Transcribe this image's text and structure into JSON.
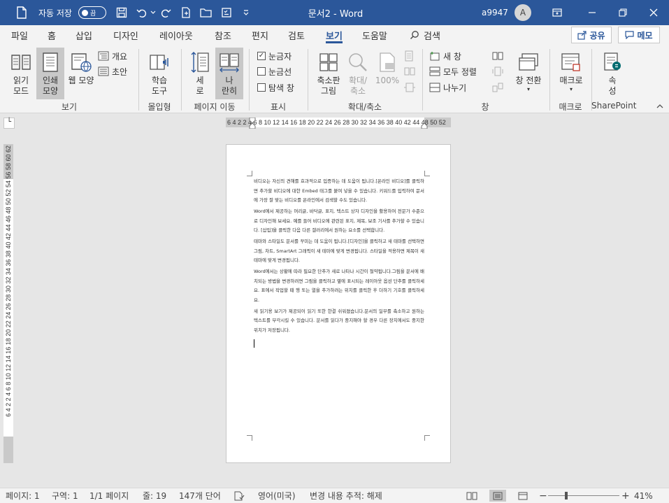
{
  "titlebar": {
    "autosave_label": "자동 저장",
    "autosave_state": "끔",
    "title": "문서2  -  Word",
    "user": "a9947",
    "avatar_initial": "A",
    "bg_color": "#2b579a"
  },
  "menu": {
    "tabs": [
      "파일",
      "홈",
      "삽입",
      "디자인",
      "레이아웃",
      "참조",
      "편지",
      "검토",
      "보기",
      "도움말",
      "검색"
    ],
    "active_tab": "보기",
    "share_label": "공유",
    "memo_label": "메모"
  },
  "ribbon": {
    "views": {
      "read_mode": "읽기\n모드",
      "print_layout": "인쇄\n모양",
      "web_layout": "웹 모양",
      "outline": "개요",
      "draft": "초안",
      "group_label": "보기"
    },
    "immersive": {
      "learning_tools": "학습\n도구",
      "group_label": "몰입형"
    },
    "page_movement": {
      "vertical": "세\n로",
      "side_to_side": "나\n란히",
      "group_label": "페이지 이동"
    },
    "show": {
      "ruler": "눈금자",
      "ruler_checked": true,
      "gridlines": "눈금선",
      "gridlines_checked": false,
      "nav_pane": "탐색 창",
      "nav_pane_checked": false,
      "group_label": "표시"
    },
    "zoom": {
      "zoom": "축소판\n그림",
      "zoom_btn": "확대/\n축소",
      "percent": "100%",
      "group_label": "확대/축소"
    },
    "window": {
      "new_window": "새 창",
      "arrange_all": "모두 정렬",
      "split": "나누기",
      "switch_windows": "창 전환",
      "group_label": "창"
    },
    "macros": {
      "macros": "매크로",
      "group_label": "매크로"
    },
    "sharepoint": {
      "properties": "속\n성",
      "group_label": "SharePoint"
    }
  },
  "ruler": {
    "horizontal": "6  4  2     2  4  6  8 10 12 14 16 18 20 22 24 26 28 30 32 34 36 38 40 42 44   48 50 52",
    "vertical": "6  4  2     2  4  6  8 10 12 14 16 18 20 22 24 26 28 30 32 34 36 38 40 42 44 46 48 50 52 54 56 58 60 62"
  },
  "document": {
    "paragraphs": [
      "비디오는 자신의 견해를 효과적으로 입증하는 데 도움이 됩니다.[온라인 비디오]를 클릭하면 추가할 비디오에 대한 Embed 태그를 붙여 넣을 수 있습니다. 키워드를 입력하여 문서에 가장 잘 맞는 비디오를 온라인에서 검색할 수도 있습니다.",
      "Word에서 제공하는 머리글, 바닥글, 표지, 텍스트 상자 디자인을 활용하여 전문가 수준으로 디자인해 보세요. 예를 들어 비디오에 관련된 표지, 제목, 보조 기사를 추가할 수 있습니다. [삽입]을 클릭한 다음 다른 갤러리에서 원하는 요소를 선택합니다.",
      "테마와 스타일도 문서를 꾸미는 데 도움이 됩니다.[디자인]을 클릭하고 새 테마를 선택하면 그림, 차트, SmartArt 그래픽이 새 테마에 맞게 변경됩니다. 스타일을 적용하면 제목이 새 테마에 맞게 변경됩니다.",
      "Word에서는 상황에 따라 필요한 단추가 새로 나타나 시간이 절약됩니다.그림을 문서에 배치되는 방법을 변경하려면 그림을 클릭하고 옆에 표시되는 레이아웃 옵션 단추를 클릭하세요. 표에서 작업할 때 행 또는 열을 추가하려는 위치를 클릭한 후 더하기 기호를 클릭하세요.",
      "새 읽기용 보기가 제공되어 읽기 또한 한결 쉬워졌습니다.문서의 일부를 축소하고 원하는 텍스트를 부각시킬 수 있습니다. 문서를 읽다가 중지해야 할 경우 다른 장치에서도 중지한 위치가 저장됩니다."
    ]
  },
  "status": {
    "page": "페이지: 1",
    "section": "구역: 1",
    "page_of": "1/1 페이지",
    "line": "줄: 19",
    "words": "147개 단어",
    "language": "영어(미국)",
    "track_changes": "변경 내용 추적: 해제",
    "zoom_percent": "41%",
    "zoom_level": 0.41
  }
}
